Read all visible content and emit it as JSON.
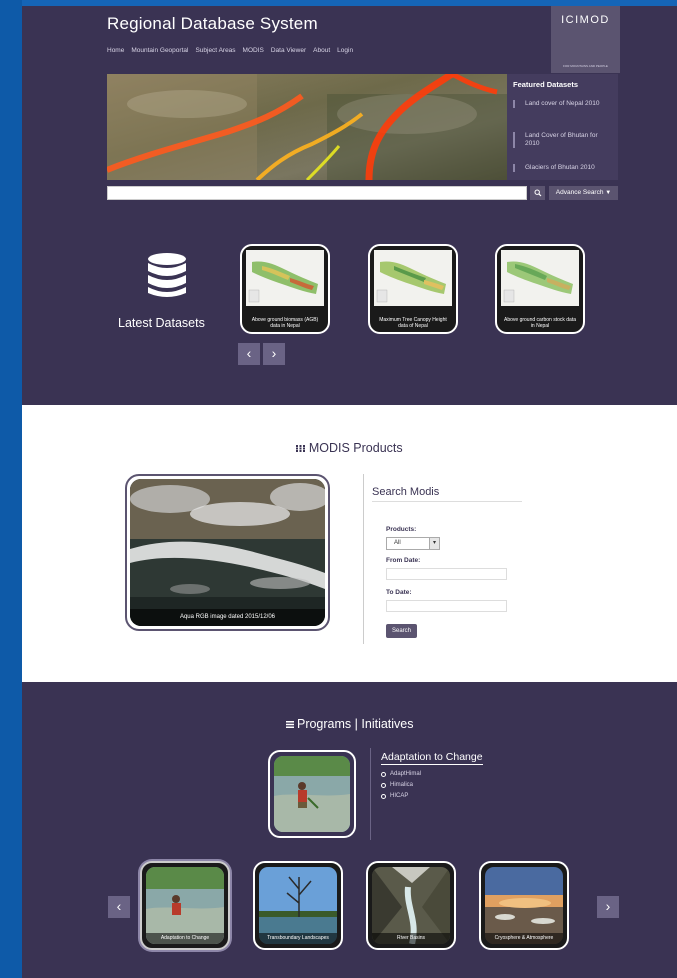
{
  "header": {
    "site_title": "Regional Database System",
    "logo_text": "ICIMOD",
    "logo_subtext": "FOR MOUNTAINS AND PEOPLE"
  },
  "nav": {
    "items": [
      {
        "label": "Home"
      },
      {
        "label": "Mountain Geoportal"
      },
      {
        "label": "Subject Areas"
      },
      {
        "label": "MODIS"
      },
      {
        "label": "Data Viewer"
      },
      {
        "label": "About"
      },
      {
        "label": "Login"
      }
    ]
  },
  "featured": {
    "title": "Featured Datasets",
    "items": [
      {
        "label": "Land cover of Nepal 2010"
      },
      {
        "label": "Land Cover of Bhutan for 2010"
      },
      {
        "label": "Glaciers of Bhutan 2010"
      }
    ]
  },
  "search": {
    "button_icon": "search-icon",
    "advance_label": "Advance Search"
  },
  "latest": {
    "label": "Latest Datasets",
    "icon": "database-icon",
    "cards": [
      {
        "caption": "Above ground biomass (AGB) data in Nepal"
      },
      {
        "caption": "Maximum Tree Canopy Height data of Nepal"
      },
      {
        "caption": "Above ground carbon stock data in Nepal"
      }
    ],
    "prev_icon": "chevron-left-icon",
    "next_icon": "chevron-right-icon"
  },
  "modis": {
    "title": "MODIS Products",
    "title_icon": "grid-icon",
    "image_caption": "Aqua RGB image dated 2015/12/06",
    "search_title": "Search Modis",
    "products_label": "Products:",
    "products_value": "All",
    "from_label": "From Date:",
    "to_label": "To Date:",
    "search_button": "Search"
  },
  "programs": {
    "title_a": "Programs",
    "title_sep": "|",
    "title_b": "Initiatives",
    "title_icon": "list-icon",
    "featured_title": "Adaptation to Change",
    "bullets": [
      {
        "label": "AdaptHimal"
      },
      {
        "label": "Himalica"
      },
      {
        "label": "HICAP"
      }
    ],
    "cards": [
      {
        "caption": "Adaptation to Change"
      },
      {
        "caption": "Transboundary Landscapes"
      },
      {
        "caption": "River Basins"
      },
      {
        "caption": "Cryosphere & Atmosphere"
      }
    ]
  },
  "colors": {
    "brand_dark": "#3a3353",
    "accent": "#5b5470",
    "outer_blue": "#0e5aa8"
  }
}
